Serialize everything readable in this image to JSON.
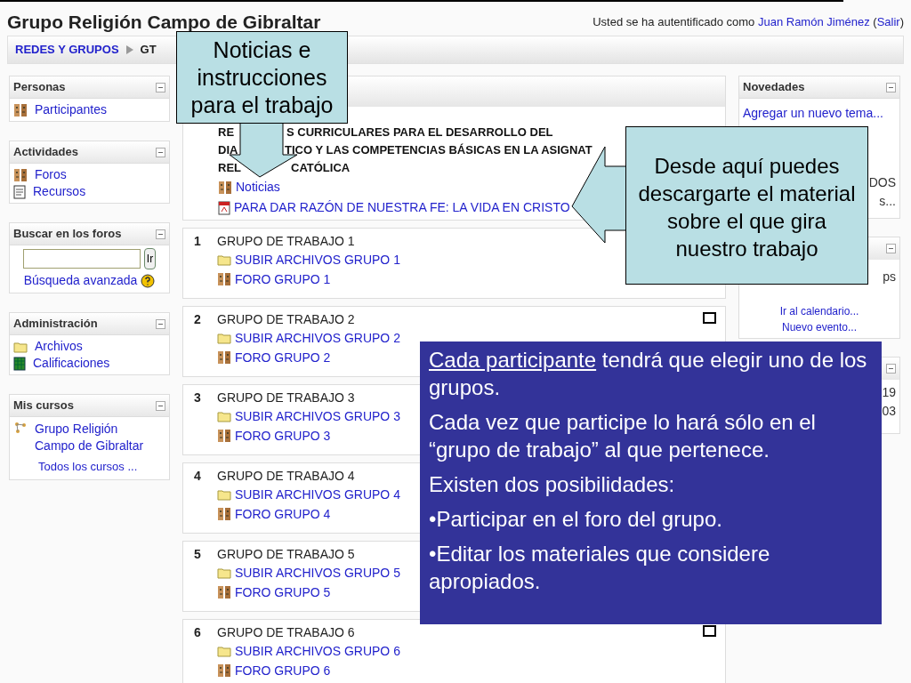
{
  "header": {
    "site_title": "Grupo Religión Campo de Gibraltar",
    "login_prefix": "Usted se ha autentificado como",
    "user_name": "Juan Ramón Jiménez",
    "logout_open": "(",
    "logout": "Salir",
    "logout_close": ")"
  },
  "breadcrumb": [
    {
      "label": "REDES Y GRUPOS"
    },
    {
      "label": "GT"
    }
  ],
  "left_blocks": [
    {
      "kind": "links",
      "title": "Personas",
      "items": [
        {
          "kind": "forum",
          "label": "Participantes"
        }
      ]
    },
    {
      "kind": "links",
      "title": "Actividades",
      "items": [
        {
          "kind": "forum",
          "label": "Foros"
        },
        {
          "kind": "resource",
          "label": "Recursos"
        }
      ]
    },
    {
      "kind": "search",
      "title": "Buscar en los foros",
      "button": "Ir",
      "link": "Búsqueda avanzada"
    },
    {
      "kind": "links",
      "title": "Administración",
      "items": [
        {
          "kind": "folder",
          "label": "Archivos"
        },
        {
          "kind": "grades",
          "label": "Calificaciones"
        }
      ]
    },
    {
      "kind": "courses",
      "title": "Mis cursos",
      "items": [
        {
          "kind": "course",
          "label": "Grupo Religión Campo de Gibraltar"
        }
      ],
      "footer": "Todos los cursos ..."
    }
  ],
  "intro_section": {
    "heading_lines": [
      [
        "RE",
        "S CURRICULARES PARA EL DESARROLLO DEL"
      ],
      [
        "DIA",
        "TICO Y LAS COMPETENCIAS BÁSICAS EN LA ASIGNAT"
      ],
      [
        "REL",
        "CATÓLICA"
      ]
    ],
    "items": [
      {
        "kind": "forum",
        "label": "Noticias"
      },
      {
        "kind": "pdf",
        "label": "PARA DAR RAZÓN DE NUESTRA FE: LA VIDA EN CRISTO"
      }
    ]
  },
  "groups": [
    {
      "number": "1",
      "title": "GRUPO DE TRABAJO 1",
      "upload": "SUBIR ARCHIVOS GRUPO 1",
      "forum": "FORO GRUPO 1",
      "toggle_shown": false
    },
    {
      "number": "2",
      "title": "GRUPO DE TRABAJO 2",
      "upload": "SUBIR ARCHIVOS GRUPO 2",
      "forum": "FORO GRUPO 2",
      "toggle_shown": true
    },
    {
      "number": "3",
      "title": "GRUPO DE TRABAJO 3",
      "upload": "SUBIR ARCHIVOS GRUPO 3",
      "forum": "FORO GRUPO 3",
      "toggle_shown": false
    },
    {
      "number": "4",
      "title": "GRUPO DE TRABAJO 4",
      "upload": "SUBIR ARCHIVOS GRUPO 4",
      "forum": "FORO GRUPO 4",
      "toggle_shown": false
    },
    {
      "number": "5",
      "title": "GRUPO DE TRABAJO 5",
      "upload": "SUBIR ARCHIVOS GRUPO 5",
      "forum": "FORO GRUPO 5",
      "toggle_shown": false
    },
    {
      "number": "6",
      "title": "GRUPO DE TRABAJO 6",
      "upload": "SUBIR ARCHIVOS GRUPO 6",
      "forum": "FORO GRUPO 6",
      "toggle_shown": true
    }
  ],
  "right_blocks": [
    {
      "title": "Novedades",
      "link": "Agregar un nuevo tema...",
      "fragments": [
        "DOS",
        "s..."
      ]
    },
    {
      "fragments": [
        "ps"
      ],
      "links": [
        "Ir al calendario...",
        "Nuevo evento..."
      ]
    },
    {
      "fragments": [
        "19",
        "03"
      ]
    }
  ],
  "callouts": [
    {
      "kind": "down",
      "lines": [
        "Noticias e",
        "instrucciones",
        "para el trabajo"
      ]
    },
    {
      "kind": "left",
      "lines": [
        "Desde aquí puedes",
        "descargarte el material",
        "sobre el que gira",
        "nuestro trabajo"
      ]
    }
  ],
  "note": {
    "paragraphs": [
      {
        "underlined": "Cada participante",
        "text": " tendrá que elegir uno de los grupos."
      },
      {
        "text": "Cada vez que participe lo hará sólo en el “grupo de trabajo” al que pertenece."
      },
      {
        "text": "Existen dos posibilidades:"
      },
      {
        "text": "•Participar en el foro del grupo."
      },
      {
        "text": "•Editar los materiales que considere apropiados."
      }
    ]
  }
}
